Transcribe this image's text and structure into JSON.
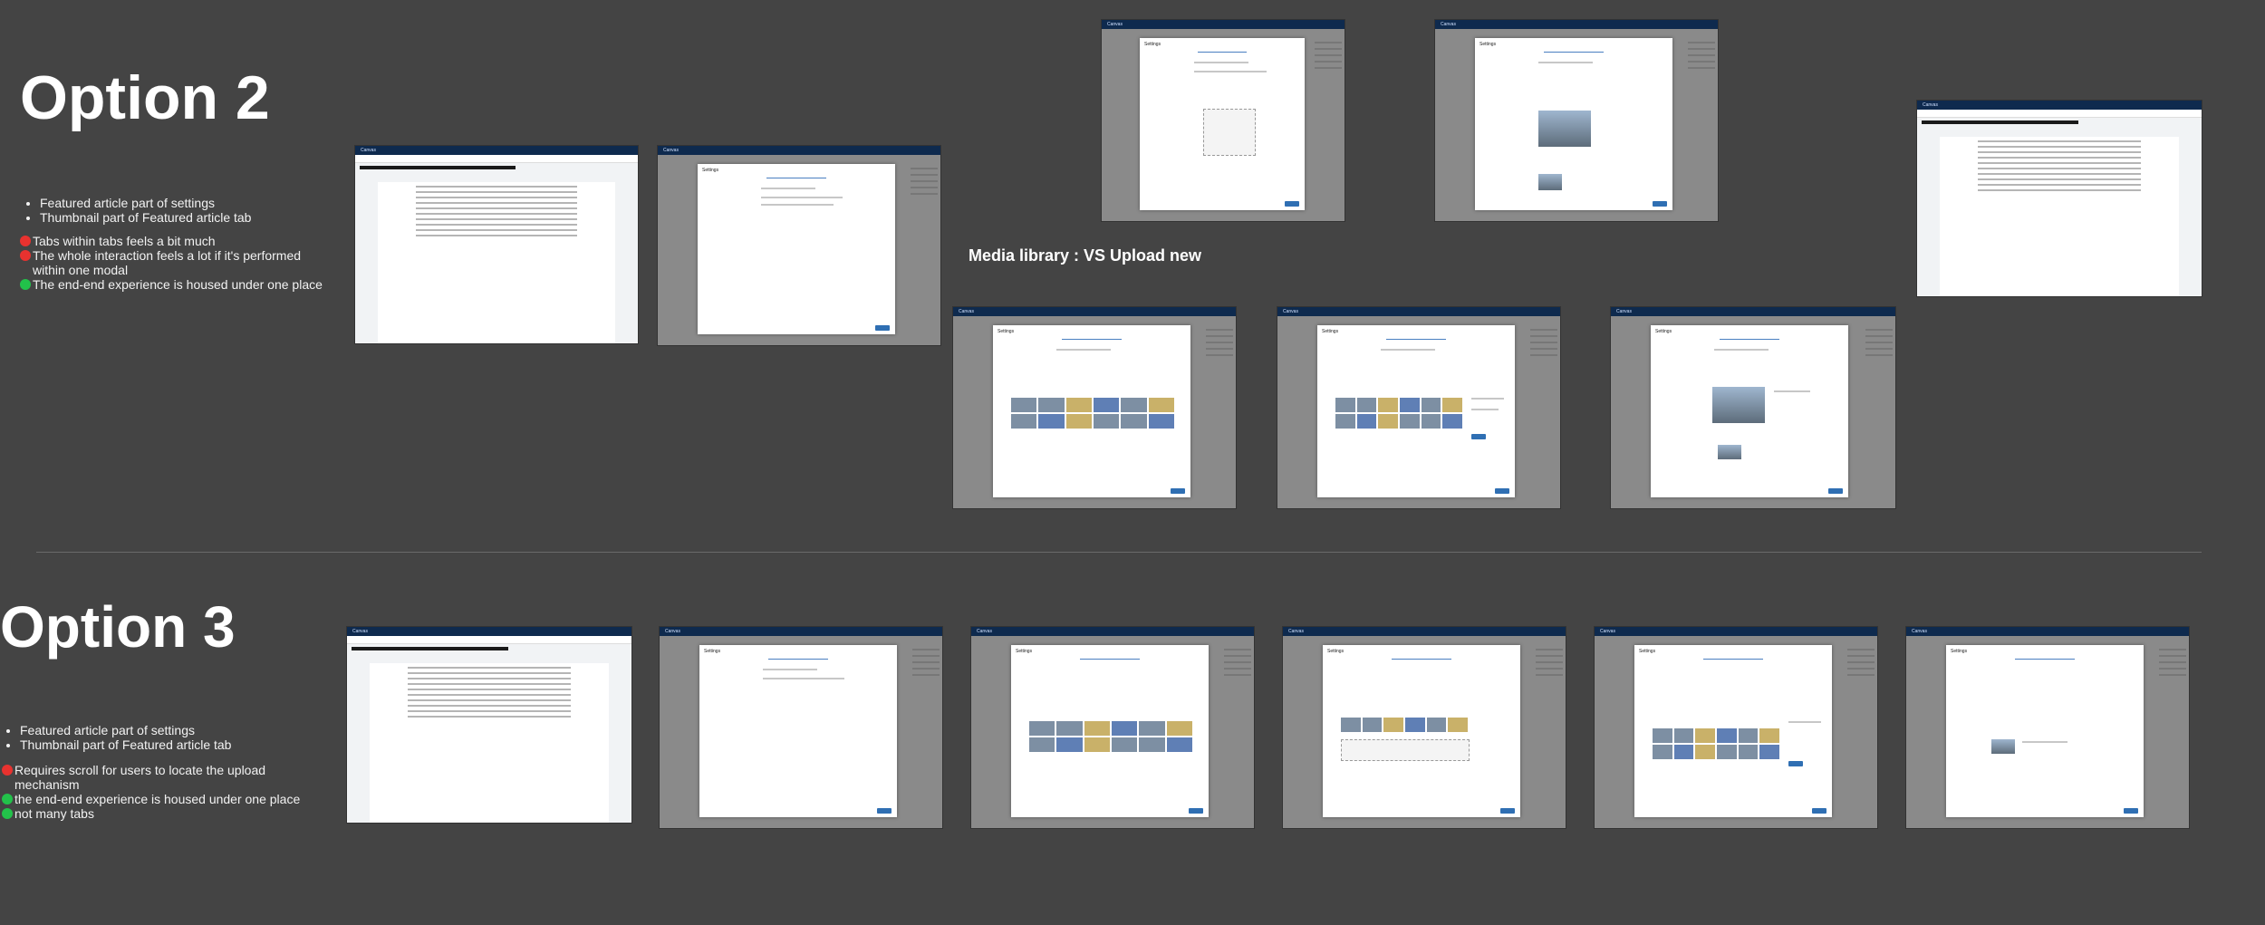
{
  "option2": {
    "title": "Option 2",
    "bullets": [
      "Featured article part of settings",
      "Thumbnail part of Featured article tab"
    ],
    "notes": [
      {
        "status": "red",
        "text": "Tabs within tabs feels a bit much"
      },
      {
        "status": "red",
        "text": "The whole interaction feels a lot if it's performed within one modal"
      },
      {
        "status": "green",
        "text": "The end-end experience is housed under one place"
      }
    ],
    "media_caption": "Media library :  VS Upload new"
  },
  "option3": {
    "title": "Option 3",
    "bullets": [
      "Featured article part of settings",
      "Thumbnail part of Featured article tab"
    ],
    "notes": [
      {
        "status": "red",
        "text": "Requires scroll for users to locate the upload mechanism"
      },
      {
        "status": "green",
        "text": "the end-end experience is housed under one place"
      },
      {
        "status": "green",
        "text": "not many tabs"
      }
    ]
  },
  "thumbnails": {
    "brand": "Canvas",
    "modal_title": "Settings"
  },
  "colors": {
    "background": "#444444",
    "status_red": "#e8322f",
    "status_green": "#22c24a",
    "app_header": "#0e2a4e",
    "accent_blue": "#2f6fb3"
  }
}
